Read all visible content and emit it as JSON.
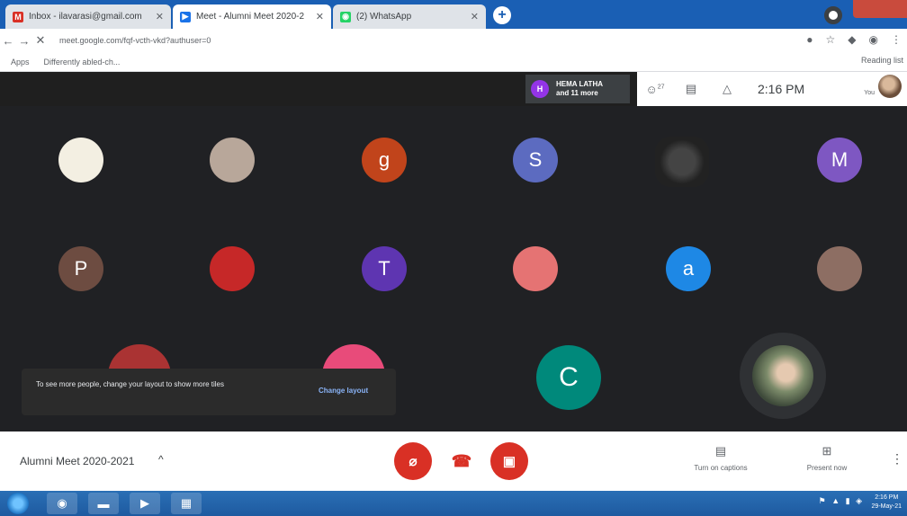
{
  "browser": {
    "tabs": [
      {
        "label": "Inbox - ilavarasi@gmail.com",
        "icon": "gmail-icon",
        "color": "#d93025"
      },
      {
        "label": "Meet - Alumni Meet 2020-2",
        "icon": "meet-icon",
        "color": "#1a73e8"
      },
      {
        "label": "(2) WhatsApp",
        "icon": "whatsapp-icon",
        "color": "#25d366"
      }
    ],
    "url": "meet.google.com/fqf-vcth-vkd?authuser=0",
    "bookmarks": [
      "Apps",
      "Differently abled-ch..."
    ],
    "reading_list": "Reading list"
  },
  "meet": {
    "presenter": {
      "initial": "H",
      "name": "HEMA LATHA",
      "more": "and 11 more"
    },
    "people_count": "27",
    "clock": "2:16 PM",
    "you_label": "You",
    "participants": [
      {
        "kind": "photo",
        "color": "#f3efe2"
      },
      {
        "kind": "photo",
        "color": "#b8a79a"
      },
      {
        "kind": "letter",
        "letter": "g",
        "color": "#c1441b"
      },
      {
        "kind": "letter",
        "letter": "S",
        "color": "#5c6bc0"
      },
      {
        "kind": "letter",
        "letter": "M",
        "color": "#7e57c2"
      },
      {
        "kind": "letter",
        "letter": "P",
        "color": "#6d4c41"
      },
      {
        "kind": "photo",
        "color": "#c62828"
      },
      {
        "kind": "letter",
        "letter": "T",
        "color": "#5e35b1"
      },
      {
        "kind": "photo",
        "color": "#e57373"
      },
      {
        "kind": "letter",
        "letter": "a",
        "color": "#1e88e5"
      },
      {
        "kind": "photo",
        "color": "#8d6e63"
      },
      {
        "kind": "letter",
        "letter": "C",
        "color": "#00897b"
      }
    ],
    "tooltip": {
      "message": "To see more people, change your layout to show more tiles",
      "action": "Change layout"
    },
    "meeting_title": "Alumni Meet 2020-2021",
    "captions_label": "Turn on captions",
    "present_label": "Present now"
  },
  "taskbar": {
    "time": "2:16 PM",
    "date": "29-May-21"
  }
}
